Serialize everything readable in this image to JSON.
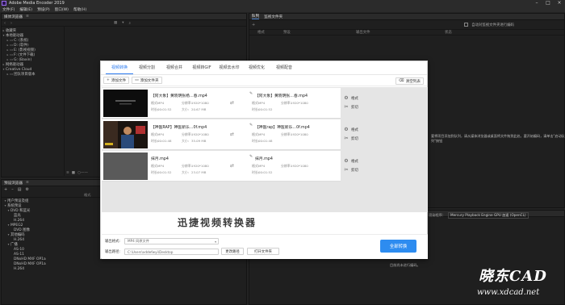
{
  "window": {
    "title": "Adobe Media Encoder 2019"
  },
  "menu": [
    "文件(F)",
    "编辑(E)",
    "预设(P)",
    "窗口(W)",
    "帮助(H)"
  ],
  "media_browser": {
    "title": "媒体浏览器",
    "tree": [
      {
        "label": "收藏夹",
        "indent": 0
      },
      {
        "label": "本地驱动器",
        "indent": 0
      },
      {
        "label": "C: (系统)",
        "indent": 1
      },
      {
        "label": "D: (软件)",
        "indent": 1
      },
      {
        "label": "E: (影视视频)",
        "indent": 1
      },
      {
        "label": "F: (文件下载)",
        "indent": 1
      },
      {
        "label": "G: (Baxin)",
        "indent": 1
      },
      {
        "label": "网络驱动器",
        "indent": 0
      },
      {
        "label": "Creative Cloud",
        "indent": 0
      },
      {
        "label": "团队项目版本",
        "indent": 1
      }
    ]
  },
  "preset_browser": {
    "title": "预设浏览器",
    "col_header": "格式",
    "items": [
      "用户预设及组",
      "系统预设",
      "DVD 和蓝光",
      "蓝光",
      "H.264",
      "MPEG2",
      "DVD 图像",
      "其他编码",
      "H.264",
      "广播",
      "AS-10",
      "AS-11",
      "DNxHD MXF OP1a",
      "DNxHD MXF OP1a",
      "H.264"
    ]
  },
  "queue": {
    "tabs": [
      "队列",
      "监视文件夹"
    ],
    "columns": [
      "格式",
      "预设",
      "输出文件",
      "状态"
    ],
    "auto_encode_label": "自动对监视文件夹进行编码",
    "hint": "要将项目添加到队列，请从媒体浏览器或桌面将文件拖到此处。要开始编码，请单击\"启动队列\"按钮"
  },
  "encoding": {
    "renderer_label": "渲染程序：",
    "renderer_value": "Mercury Playback Engine GPU 加速 (OpenCL)",
    "idle_text": "目前尚未进行编码。"
  },
  "modal": {
    "tabs": [
      "视频转换",
      "视频分割",
      "视频合并",
      "视频转GIF",
      "视频去水印",
      "视频优化",
      "视频配音"
    ],
    "active_tab": 0,
    "add_file": "添加文件",
    "add_folder": "添加文件夹",
    "clear_list": "清空列表",
    "files": [
      {
        "src_name": "【阿大象】黄晓明张杨…春.mp4",
        "src_format": "MP4",
        "src_res": "1920*1080",
        "src_dur": "00:01:52",
        "src_size": "20.67 MB",
        "dst_name": "【阿大象】黄晓明张…春.mp4",
        "dst_format": "MP4",
        "dst_res": "1920*1080",
        "dst_dur": "00:01:52",
        "thumb": "dark"
      },
      {
        "src_name": "【神医RAP】神医新乐…0f.mp4",
        "src_format": "MP4",
        "src_res": "1920*1080",
        "src_dur": "00:01:48",
        "src_size": "35.09 MB",
        "dst_name": "【神医rap】神医新乐…0f.mp4",
        "dst_format": "MP4",
        "dst_res": "1920*1080",
        "dst_dur": "00:01:48",
        "thumb": "person"
      },
      {
        "src_name": "抹月.mp4",
        "src_format": "MP4",
        "src_res": "1920*1080",
        "src_dur": "00:01:52",
        "src_size": "23.07 MB",
        "dst_name": "抹月.mp4",
        "dst_format": "MP4",
        "dst_res": "1920*1080",
        "dst_dur": "00:01:52",
        "thumb": "gray"
      }
    ],
    "labels": {
      "format": "格式:",
      "resolution": "分辨率:",
      "duration": "时长:",
      "size": "大小:",
      "settings": "格式",
      "clip": "剪切"
    },
    "brand": "迅捷视频转换器",
    "output_format_label": "输出格式:",
    "output_format_value": "MP4  同原文件",
    "output_path_label": "输出路径:",
    "output_path_value": "C:\\Users\\xddefwyi\\Desktop",
    "change_path": "更改路径",
    "open_folder": "打开文件夹",
    "convert_all": "全部转换"
  },
  "watermark": {
    "line1": "晓东CAD",
    "line2": "www.xdcad.net"
  }
}
